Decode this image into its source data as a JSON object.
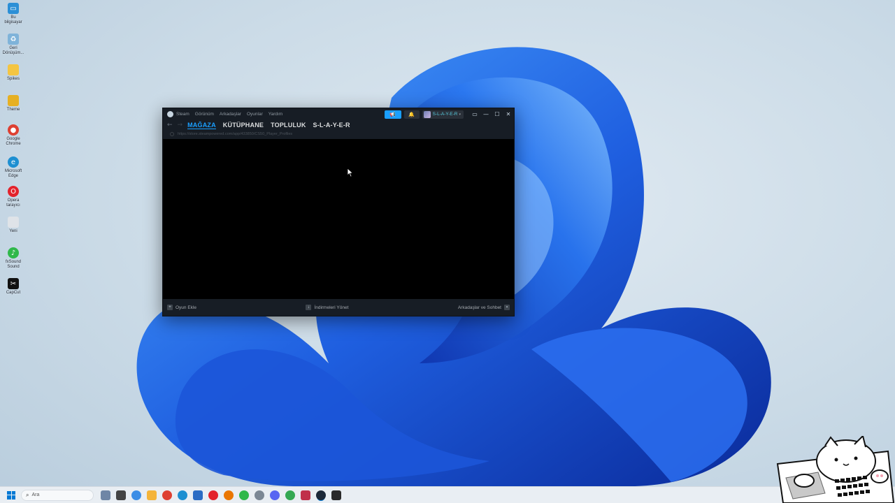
{
  "desktop": {
    "icons": [
      {
        "label": "Bu bilgisayar",
        "icon": "monitor-icon",
        "color": "#2b8fd6"
      },
      {
        "label": "Geri Dönüşüm...",
        "icon": "recycle-bin-icon",
        "color": "#7fb3d9"
      },
      {
        "label": "Spikes",
        "icon": "folder-icon",
        "color": "#f4c542"
      },
      {
        "label": "Theme",
        "icon": "theme-icon",
        "color": "#e6b023"
      },
      {
        "label": "Google Chrome",
        "icon": "chrome-icon",
        "color": "#de4032"
      },
      {
        "label": "Microsoft Edge",
        "icon": "edge-icon",
        "color": "#1d8fd1"
      },
      {
        "label": "Opera tarayıcı",
        "icon": "opera-icon",
        "color": "#e3232c"
      },
      {
        "label": "Yeni",
        "icon": "file-icon",
        "color": "#dfe3e8"
      },
      {
        "label": "fxSound Sound",
        "icon": "fxsound-icon",
        "color": "#2fb84a"
      },
      {
        "label": "CapCut",
        "icon": "capcut-icon",
        "color": "#111111"
      }
    ]
  },
  "steam": {
    "menu": [
      "Steam",
      "Görünüm",
      "Arkadaşlar",
      "Oyunlar",
      "Yardım"
    ],
    "account_name": "S-L-A-Y-E-R",
    "tabs": [
      "MAĞAZA",
      "KÜTÜPHANE",
      "TOPLULUK",
      "S-L-A-Y-E-R"
    ],
    "url": "https://store.steampowered.com/app/433850/CS50_Player_Profiles",
    "bottom": {
      "add_game": "Oyun Ekle",
      "downloads": "İndirmeleri Yönet",
      "friends_chat": "Arkadaşlar ve Sohbet"
    },
    "accent_color": "#1a9fff"
  },
  "taskbar": {
    "search_placeholder": "Ara",
    "apps": [
      {
        "icon": "widgets-icon",
        "color": "#6f86a6"
      },
      {
        "icon": "task-view-icon",
        "color": "#444444"
      },
      {
        "icon": "copilot-icon",
        "color": "#3c8ee6"
      },
      {
        "icon": "file-explorer-icon",
        "color": "#f4b43a"
      },
      {
        "icon": "chrome-icon",
        "color": "#de4032"
      },
      {
        "icon": "edge-icon",
        "color": "#1d8fd1"
      },
      {
        "icon": "store-icon",
        "color": "#2b6cc4"
      },
      {
        "icon": "opera-icon",
        "color": "#e3232c"
      },
      {
        "icon": "blender-icon",
        "color": "#ea7600"
      },
      {
        "icon": "razer-icon",
        "color": "#2fb84a"
      },
      {
        "icon": "settings-icon",
        "color": "#7b8794"
      },
      {
        "icon": "discord-icon",
        "color": "#5865f2"
      },
      {
        "icon": "chrome-alt-icon",
        "color": "#34a853"
      },
      {
        "icon": "app-icon",
        "color": "#c0304a"
      },
      {
        "icon": "steam-icon",
        "color": "#1b2838"
      },
      {
        "icon": "epic-games-icon",
        "color": "#2a2a2a"
      }
    ]
  }
}
